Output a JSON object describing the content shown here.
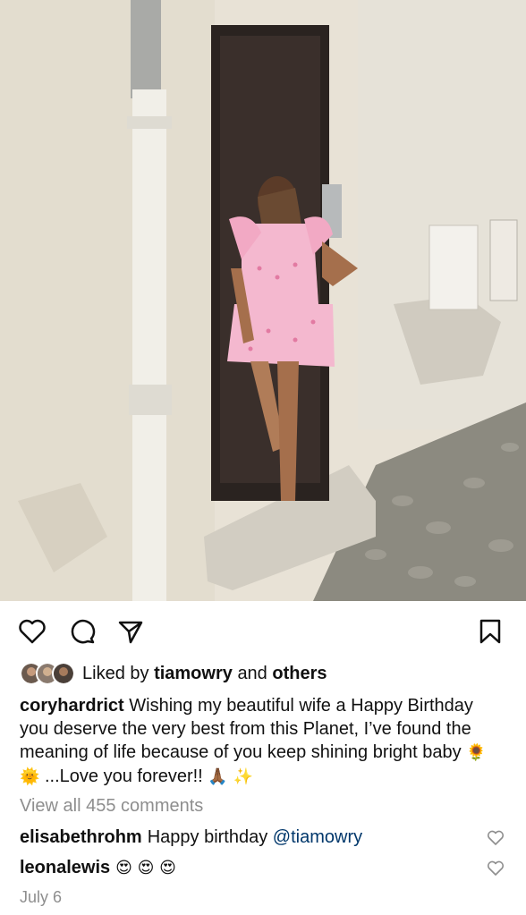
{
  "post": {
    "liked_by_prefix": "Liked by",
    "liked_by_user": "tiamowry",
    "liked_by_and": "and",
    "liked_by_others": "others",
    "caption_user": "coryhardrict",
    "caption_text_1": "Wishing my beautiful wife a Happy Birthday you deserve the very best from this Planet, I’ve found the meaning of life because of you keep shining bright baby",
    "caption_emoji_1": "🌻 🌞",
    "caption_text_2": "...Love you forever!!",
    "caption_emoji_2": "🙏🏾 ✨",
    "view_all_comments": "View all 455 comments",
    "date": "July 6"
  },
  "comments": [
    {
      "user": "elisabethrohm",
      "text": "Happy birthday",
      "mention": "@tiamowry"
    },
    {
      "user": "leonalewis",
      "text": "😍 😍 😍"
    }
  ],
  "icons": {
    "like": "heart-icon",
    "comment": "comment-icon",
    "share": "send-icon",
    "save": "bookmark-icon"
  },
  "colors": {
    "text": "#111111",
    "muted": "#8e8e8e",
    "mention": "#00376b",
    "dress": "#f4b8cf"
  }
}
